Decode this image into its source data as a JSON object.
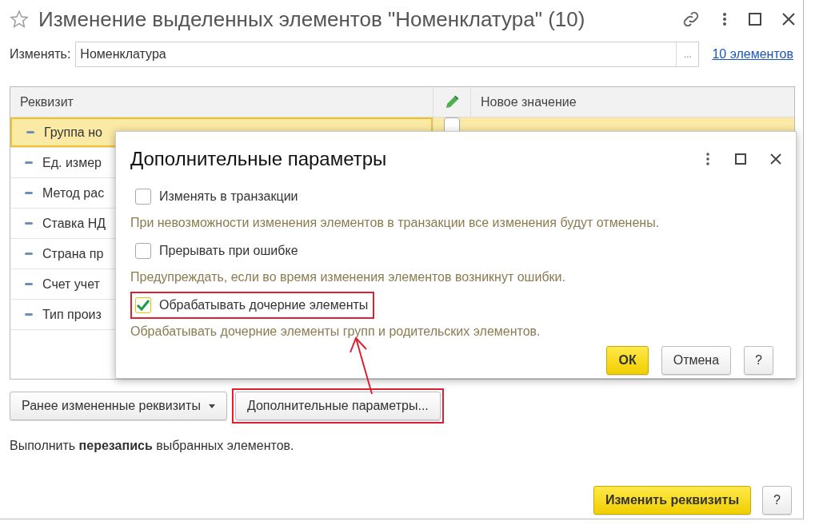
{
  "window": {
    "title": "Изменение выделенных элементов \"Номенклатура\" (10)"
  },
  "edit_field": {
    "label": "Изменять:",
    "value": "Номенклатура",
    "choose_button": "...",
    "link": "10 элементов"
  },
  "table": {
    "columns": [
      "Реквизит",
      "Новое значение"
    ],
    "rows": [
      {
        "name": "Группа но",
        "selected": true,
        "checked": false
      },
      {
        "name": "Ед. измер",
        "selected": false
      },
      {
        "name": "Метод рас",
        "selected": false
      },
      {
        "name": "Ставка НД",
        "selected": false
      },
      {
        "name": "Страна пр",
        "selected": false
      },
      {
        "name": "Счет учет",
        "selected": false
      },
      {
        "name": "Тип произ",
        "selected": false
      }
    ]
  },
  "dialog": {
    "title": "Дополнительные параметры",
    "options": [
      {
        "label": "Изменять в транзакции",
        "hint": "При невозможности изменения элементов в транзакции все изменения будут отменены.",
        "checked": false,
        "annotated": false
      },
      {
        "label": "Прерывать при ошибке",
        "hint": "Предупреждать, если во время изменения элементов возникнут ошибки.",
        "checked": false,
        "annotated": false
      },
      {
        "label": "Обрабатывать дочерние элементы",
        "hint": "Обрабатывать дочерние элементы групп и родительских элементов.",
        "checked": true,
        "annotated": true
      }
    ],
    "buttons": [
      {
        "label": "ОК",
        "kind": "primary"
      },
      {
        "label": "Отмена",
        "kind": "default"
      },
      {
        "label": "?",
        "kind": "help"
      }
    ]
  },
  "actions": [
    {
      "label": "Ранее измененные реквизиты",
      "kind": "dropdown",
      "annotated": false
    },
    {
      "label": "Дополнительные параметры...",
      "kind": "default",
      "annotated": true
    }
  ],
  "note": "Выполнить **перезапись** выбранных элементов.",
  "footer_buttons": [
    {
      "label": "Изменить реквизиты",
      "kind": "primary"
    },
    {
      "label": "?",
      "kind": "help"
    }
  ]
}
